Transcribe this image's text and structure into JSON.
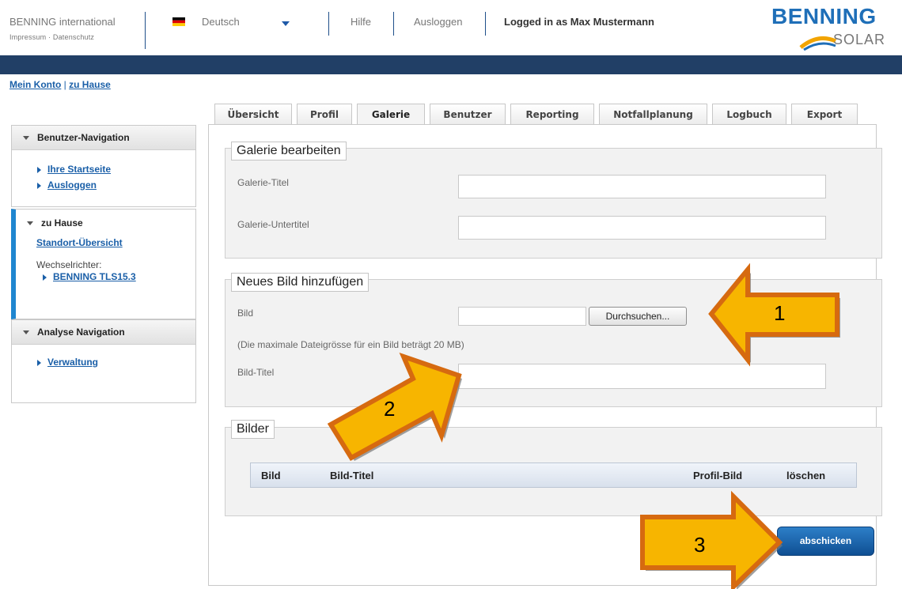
{
  "header": {
    "company": "BENNING international",
    "legal_links": "Impressum · Datenschutz",
    "language": "Deutsch",
    "help": "Hilfe",
    "logout": "Ausloggen",
    "logged_in": "Logged in as Max Mustermann",
    "logo_top": "BENNING",
    "logo_bottom": "SOLAR"
  },
  "breadcrumb": {
    "item1": "Mein Konto",
    "separator": "|",
    "item2": "zu Hause"
  },
  "sidebar": {
    "user_nav": {
      "title": "Benutzer-Navigation",
      "links": [
        "Ihre Startseite",
        "Ausloggen"
      ]
    },
    "home": {
      "title": "zu Hause",
      "overview": "Standort-Übersicht",
      "inverter_label": "Wechselrichter:",
      "inverter": "BENNING TLS15.3"
    },
    "analysis": {
      "title": "Analyse Navigation",
      "links": [
        "Verwaltung"
      ]
    }
  },
  "tabs": [
    "Übersicht",
    "Profil",
    "Galerie",
    "Benutzer",
    "Reporting",
    "Notfallplanung",
    "Logbuch",
    "Export"
  ],
  "active_tab": "Galerie",
  "gallery_edit": {
    "legend": "Galerie bearbeiten",
    "title_label": "Galerie-Titel",
    "subtitle_label": "Galerie-Untertitel",
    "title_value": "",
    "subtitle_value": ""
  },
  "new_image": {
    "legend": "Neues Bild hinzufügen",
    "image_label": "Bild",
    "browse_button": "Durchsuchen...",
    "size_note": "(Die maximale Dateigrösse für ein Bild beträgt 20 MB)",
    "image_title_label": "Bild-Titel",
    "image_title_value": ""
  },
  "images": {
    "legend": "Bilder",
    "columns": [
      "Bild",
      "Bild-Titel",
      "Profil-Bild",
      "löschen"
    ]
  },
  "submit_label": "abschicken",
  "callouts": [
    "1",
    "2",
    "3"
  ],
  "colors": {
    "banner": "#213f66",
    "link": "#1a5fa8",
    "callout_fill": "#f7b500",
    "callout_border": "#d66a10",
    "button": "#1a62ad"
  }
}
